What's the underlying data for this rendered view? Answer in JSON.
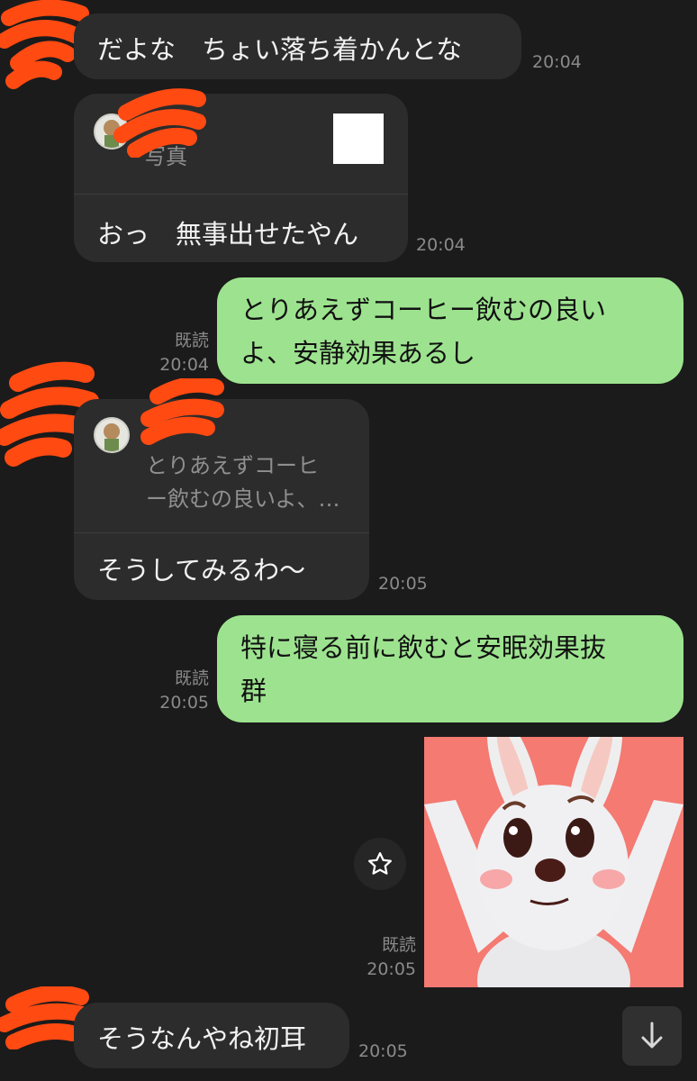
{
  "messages": [
    {
      "text": "だよな　ちょい落ち着かんとな",
      "time": "20:04"
    },
    {
      "quote_preview": "写真",
      "text": "おっ　無事出せたやん",
      "time": "20:04"
    },
    {
      "line1": "とりあえずコーヒー飲むの良い",
      "line2": "よ、安静効果あるし",
      "read": "既読",
      "time": "20:04"
    },
    {
      "quote_line1": "とりあえずコーヒ",
      "quote_line2": "ー飲むの良いよ、…",
      "text": "そうしてみるわ〜",
      "time": "20:05"
    },
    {
      "line1": "特に寝る前に飲むと安眠効果抜",
      "line2": "群",
      "read": "既読",
      "time": "20:05"
    },
    {
      "read": "既読",
      "time": "20:05",
      "sticker_icon": "rabbit-sticker"
    },
    {
      "text": "そうなんやね初耳",
      "time": "20:05"
    }
  ],
  "icons": {
    "favorite": "star-icon",
    "scroll_down": "arrow-down-icon"
  },
  "colors": {
    "background": "#1b1b1b",
    "incoming_bubble": "#2c2c2c",
    "outgoing_bubble": "#9de38f",
    "redaction": "#ff4a12"
  }
}
